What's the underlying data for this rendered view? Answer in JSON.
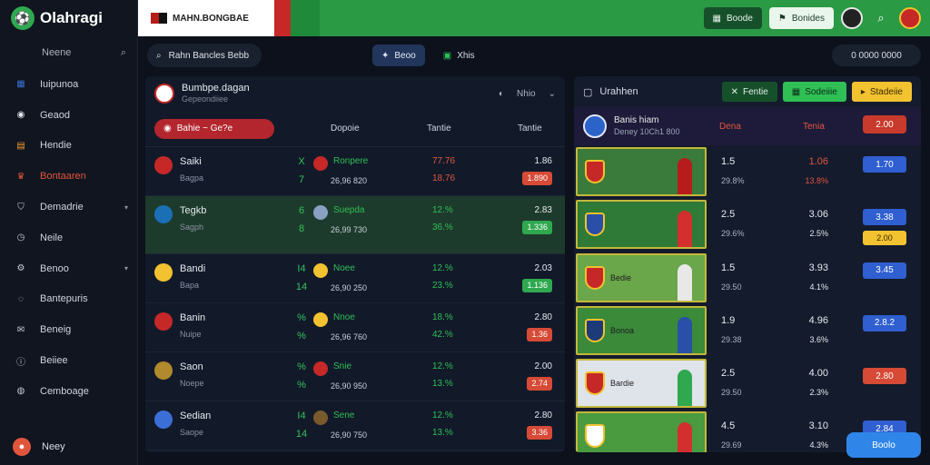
{
  "app": {
    "logo_text": "Olahragi",
    "brand_text": "MAHN.BONGBAE"
  },
  "topbar": {
    "btn1": "Boode",
    "btn2": "Bonides"
  },
  "sidebar": {
    "search_label": "Neene",
    "items": [
      {
        "label": "Iuipunoa",
        "icon": "grid-icon",
        "color": "#3b6fd6"
      },
      {
        "label": "Geaod",
        "icon": "ball-icon",
        "color": "#e6e9ee"
      },
      {
        "label": "Hendie",
        "icon": "calendar-icon",
        "color": "#f09a2c"
      },
      {
        "label": "Bontaaren",
        "icon": "trophy-icon",
        "color": "#e2553d"
      },
      {
        "label": "Demadrie",
        "icon": "shield-icon",
        "color": "#c9cdd4"
      },
      {
        "label": "Neile",
        "icon": "clock-icon",
        "color": "#c9cdd4"
      },
      {
        "label": "Benoo",
        "icon": "settings-icon",
        "color": "#c9cdd4"
      },
      {
        "label": "Bantepuris",
        "icon": "chat-icon",
        "color": "#c9cdd4"
      },
      {
        "label": "Beneig",
        "icon": "message-icon",
        "color": "#c9cdd4"
      },
      {
        "label": "Beiiee",
        "icon": "info-icon",
        "color": "#c9cdd4"
      },
      {
        "label": "Cemboage",
        "icon": "globe-icon",
        "color": "#c9cdd4"
      }
    ],
    "footer_label": "Neey"
  },
  "filters": {
    "search_text": "Rahn Bancles Bebb",
    "chip_active": "Beoo",
    "chip_plain": "Xhis",
    "chip_right": "0 0000 0000"
  },
  "left_panel": {
    "title": "Bumbpe.dagan",
    "subtitle": "Gepeondiiee",
    "tool_text": "Nhio",
    "chip_text": "Bahie ~ Ge?e",
    "col_a": "Dopoie",
    "col_b": "Tantie",
    "col_c": "Tantie",
    "rows": [
      {
        "team": "Saiki",
        "team_sub": "Bagpa",
        "s1": "X",
        "s2": "7",
        "opp": "Ronpere",
        "time": "26,96 820",
        "p1": "77.76",
        "p2": "18.76",
        "pct_color": "red",
        "odd": "1.86",
        "pill": "1.890",
        "pill_color": "red",
        "logo": "#c62828",
        "olog": "#c62828"
      },
      {
        "team": "Tegkb",
        "team_sub": "Sagph",
        "s1": "6",
        "s2": "8",
        "opp": "Suepda",
        "time": "26,99 730",
        "p1": "12.%",
        "p2": "36.%",
        "pct_color": "green",
        "odd": "2.83",
        "pill": "1.336",
        "pill_color": "green",
        "logo": "#1a6fb5",
        "olog": "#8aa0c2"
      },
      {
        "team": "Bandi",
        "team_sub": "Bapa",
        "s1": "I4",
        "s2": "14",
        "opp": "Noee",
        "time": "26,90 250",
        "p1": "12.%",
        "p2": "23.%",
        "pct_color": "green",
        "odd": "2.03",
        "pill": "1.136",
        "pill_color": "green",
        "logo": "#f2c230",
        "olog": "#f2c230"
      },
      {
        "team": "Banin",
        "team_sub": "Nuipe",
        "s1": "%",
        "s2": "%",
        "opp": "Nnoe",
        "time": "26,96 760",
        "p1": "18.%",
        "p2": "42.%",
        "pct_color": "green",
        "odd": "2.80",
        "pill": "1.36",
        "pill_color": "red",
        "logo": "#c62828",
        "olog": "#f2c230"
      },
      {
        "team": "Saon",
        "team_sub": "Noepe",
        "s1": "%",
        "s2": "%",
        "opp": "Snie",
        "time": "26,90 950",
        "p1": "12.%",
        "p2": "13.%",
        "pct_color": "green",
        "odd": "2.00",
        "pill": "2.74",
        "pill_color": "red",
        "logo": "#b08a2c",
        "olog": "#c62828"
      },
      {
        "team": "Sedian",
        "team_sub": "Saope",
        "s1": "I4",
        "s2": "14",
        "opp": "Sene",
        "time": "26,90 750",
        "p1": "12.%",
        "p2": "13.%",
        "pct_color": "green",
        "odd": "2.80",
        "pill": "3.36",
        "pill_color": "red",
        "logo": "#3b6fd6",
        "olog": "#7a5a2c"
      }
    ]
  },
  "right_panel": {
    "title": "Urahhen",
    "tab1": "Fentie",
    "tab2": "Sodeiiie",
    "tab3": "Stadeiie",
    "league_name": "Banis hiam",
    "league_sub": "Deney 10Ch1 800",
    "hdr1": "Dena",
    "hdr2": "Tenia",
    "hdr_btn": "2.00",
    "rows": [
      {
        "thumb_label": "",
        "v1": "1.5",
        "v1s": "29.8%",
        "v2": "1.06",
        "v2s": "13.8%",
        "btn": "1.70",
        "btn_color": "b",
        "btn2": "",
        "bg": "#3a7a3a",
        "shield": "#c62828",
        "player": "#b71c1c"
      },
      {
        "thumb_label": "",
        "v1": "2.5",
        "v1s": "29.6%",
        "v2": "3.06",
        "v2s": "2.5%",
        "btn": "3.38",
        "btn_color": "b",
        "btn2": "2.00",
        "bg": "#2f7a36",
        "shield": "#2a4fa8",
        "player": "#d32f2f"
      },
      {
        "thumb_label": "Bedie",
        "v1": "1.5",
        "v1s": "29.50",
        "v2": "3.93",
        "v2s": "4.1%",
        "btn": "3.45",
        "btn_color": "b",
        "btn2": "",
        "bg": "#6aa64a",
        "shield": "#c62828",
        "player": "#e8e8e8"
      },
      {
        "thumb_label": "Bonoa",
        "v1": "1.9",
        "v1s": "29.38",
        "v2": "4.96",
        "v2s": "3.6%",
        "btn": "2.8.2",
        "btn_color": "b",
        "btn2": "",
        "bg": "#3a8a3a",
        "shield": "#1d3b78",
        "player": "#2a4fa8"
      },
      {
        "thumb_label": "Bardie",
        "v1": "2.5",
        "v1s": "29.50",
        "v2": "4.00",
        "v2s": "2.3%",
        "btn": "2.80",
        "btn_color": "r",
        "btn2": "",
        "bg": "#dfe3ea",
        "shield": "#c62828",
        "player": "#2fa84f"
      },
      {
        "thumb_label": "",
        "v1": "4.5",
        "v1s": "29.69",
        "v2": "3.10",
        "v2s": "4.3%",
        "btn": "2.84",
        "btn_color": "b",
        "btn2": "",
        "bg": "#4a9a40",
        "shield": "#ffffff",
        "player": "#d32f2f"
      }
    ]
  },
  "floating_button": "Boolo"
}
